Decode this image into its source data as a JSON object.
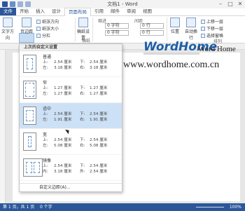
{
  "window": {
    "title": "文档1 - Word",
    "minimize": "–",
    "restore": "□",
    "close": "✕"
  },
  "tabs": [
    "文件",
    "开始",
    "插入",
    "设计",
    "页面布局",
    "引用",
    "邮件",
    "审阅",
    "视图"
  ],
  "active_tab": "页面布局",
  "ribbon": {
    "text_direction": "文字方向",
    "margins": "页边距",
    "orientation": "纸张方向",
    "size": "纸张大小",
    "columns": "分栏",
    "manuscript": "稿纸设置",
    "manuscript_group": "稿纸",
    "indent_label": "缩进",
    "spacing_label": "间距",
    "left_indent": "0 字符",
    "right_indent": "0 字符",
    "space_before": "0 行",
    "space_after": "0 行",
    "bring_forward": "上移一层",
    "send_backward": "下移一层",
    "selection_pane": "选择窗格",
    "position": "位置",
    "wrap_text": "自动换行",
    "arrange_group": "排列"
  },
  "dropdown": {
    "header": "上次的自定义设置",
    "options": [
      {
        "name": "普通",
        "top": "2.54 厘米",
        "bottom": "2.54 厘米",
        "left": "3.18 厘米",
        "right": "3.18 厘米",
        "t": "上:",
        "b": "下:",
        "l": "左:",
        "r": "右:"
      },
      {
        "name": "窄",
        "top": "1.27 厘米",
        "bottom": "1.27 厘米",
        "left": "1.27 厘米",
        "right": "1.27 厘米",
        "t": "上:",
        "b": "下:",
        "l": "左:",
        "r": "右:"
      },
      {
        "name": "适中",
        "top": "2.54 厘米",
        "bottom": "2.54 厘米",
        "left": "1.91 厘米",
        "right": "1.91 厘米",
        "t": "上:",
        "b": "下:",
        "l": "左:",
        "r": "右:"
      },
      {
        "name": "宽",
        "top": "2.54 厘米",
        "bottom": "2.54 厘米",
        "left": "5.08 厘米",
        "right": "5.08 厘米",
        "t": "上:",
        "b": "下:",
        "l": "左:",
        "r": "右:"
      },
      {
        "name": "镜像",
        "top": "2.54 厘米",
        "bottom": "2.54 厘米",
        "left": "3.18 厘米",
        "right": "2.54 厘米",
        "t": "上:",
        "b": "下:",
        "l": "内:",
        "r": "外:"
      }
    ],
    "footer": "自定义边距(A)..."
  },
  "document": {
    "brand": "WordHome",
    "brand_sub": "Word Home",
    "url": "www.wordhome.com.cn"
  },
  "status": {
    "page": "第 1 页，共 1 页",
    "words": "0 个字",
    "zoom": "100%"
  },
  "colors": {
    "accent": "#2b579a",
    "highlight": "#cde1f6"
  }
}
